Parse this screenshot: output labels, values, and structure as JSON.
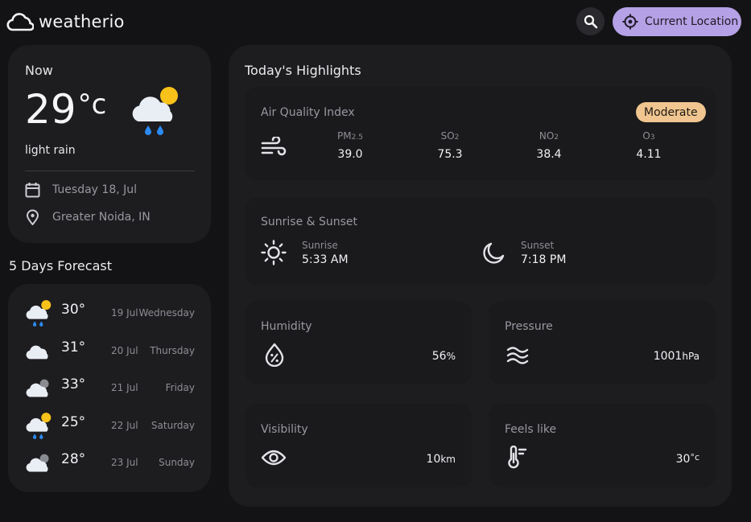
{
  "header": {
    "logo_text": "weatherio",
    "location_button": "Current Location"
  },
  "now": {
    "heading": "Now",
    "temp_value": "29",
    "temp_unit": "°c",
    "condition": "light rain",
    "date": "Tuesday 18, Jul",
    "location": "Greater Noida, IN"
  },
  "forecast": {
    "heading": "5 Days Forecast",
    "days": [
      {
        "temp": "30°",
        "date": "19 Jul",
        "weekday": "Wednesday",
        "icon": "rain-sun"
      },
      {
        "temp": "31°",
        "date": "20 Jul",
        "weekday": "Thursday",
        "icon": "cloud"
      },
      {
        "temp": "33°",
        "date": "21 Jul",
        "weekday": "Friday",
        "icon": "cloud-moon"
      },
      {
        "temp": "25°",
        "date": "22 Jul",
        "weekday": "Saturday",
        "icon": "rain-sun"
      },
      {
        "temp": "28°",
        "date": "23 Jul",
        "weekday": "Sunday",
        "icon": "cloud-moon"
      }
    ]
  },
  "highlights": {
    "heading": "Today's Highlights",
    "aqi": {
      "title": "Air Quality Index",
      "badge": "Moderate",
      "badge_color": "#f0c58f",
      "items": [
        {
          "name": "PM",
          "sub": "2.5",
          "value": "39.0"
        },
        {
          "name": "SO",
          "sub": "2",
          "value": "75.3"
        },
        {
          "name": "NO",
          "sub": "2",
          "value": "38.4"
        },
        {
          "name": "O",
          "sub": "3",
          "value": "4.11"
        }
      ]
    },
    "sun": {
      "title": "Sunrise & Sunset",
      "sunrise_label": "Sunrise",
      "sunrise_value": "5:33 AM",
      "sunset_label": "Sunset",
      "sunset_value": "7:18 PM"
    },
    "humidity": {
      "title": "Humidity",
      "value": "56",
      "unit": "%"
    },
    "pressure": {
      "title": "Pressure",
      "value": "1001",
      "unit": "hPa"
    },
    "visibility": {
      "title": "Visibility",
      "value": "10",
      "unit": "km"
    },
    "feels_like": {
      "title": "Feels like",
      "value": "30",
      "unit": "°c"
    }
  },
  "colors": {
    "accent": "#b5a1e5",
    "background": "#131315",
    "surface": "#1d1c1f"
  }
}
